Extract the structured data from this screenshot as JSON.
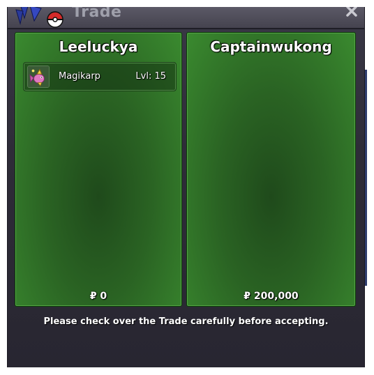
{
  "window": {
    "title": "Trade",
    "close_icon": "close-icon"
  },
  "left_panel": {
    "player_name": "Leeluckya",
    "items": [
      {
        "name": "Magikarp",
        "level": "Lvl: 15",
        "icon": "magikarp-sprite-icon"
      }
    ],
    "money": "₽ 0"
  },
  "right_panel": {
    "player_name": "Captainwukong",
    "items": [],
    "money": "₽ 200,000"
  },
  "notice": "Please check over the Trade carefully before accepting.",
  "colors": {
    "panel_green": "#2a6323",
    "window_bg": "#2e2c38",
    "title_text": "#9fa0ab"
  }
}
